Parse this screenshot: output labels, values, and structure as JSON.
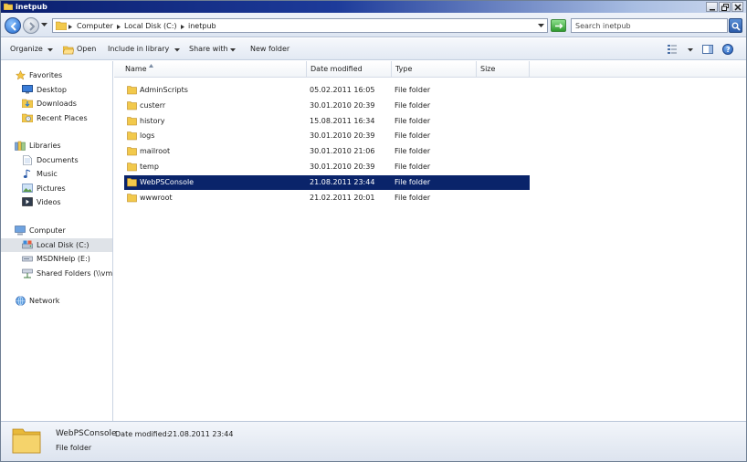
{
  "window": {
    "title": "inetpub"
  },
  "address": {
    "crumbs": [
      "Computer",
      "Local Disk (C:)",
      "inetpub"
    ],
    "search_placeholder": "Search inetpub"
  },
  "toolbar": {
    "organize": "Organize",
    "open": "Open",
    "include_in_library": "Include in library",
    "share_with": "Share with",
    "new_folder": "New folder",
    "help": "?"
  },
  "navpane": {
    "favorites": {
      "label": "Favorites",
      "items": [
        "Desktop",
        "Downloads",
        "Recent Places"
      ]
    },
    "libraries": {
      "label": "Libraries",
      "items": [
        "Documents",
        "Music",
        "Pictures",
        "Videos"
      ]
    },
    "computer": {
      "label": "Computer",
      "items": [
        "Local Disk (C:)",
        "MSDNHelp (E:)",
        "Shared Folders (\\\\vmw"
      ],
      "selected": "Local Disk (C:)"
    },
    "network": {
      "label": "Network"
    }
  },
  "filelist": {
    "columns": [
      "Name",
      "Date modified",
      "Type",
      "Size"
    ],
    "rows": [
      {
        "name": "AdminScripts",
        "date": "05.02.2011 16:05",
        "type": "File folder"
      },
      {
        "name": "custerr",
        "date": "30.01.2010 20:39",
        "type": "File folder"
      },
      {
        "name": "history",
        "date": "15.08.2011 16:34",
        "type": "File folder"
      },
      {
        "name": "logs",
        "date": "30.01.2010 20:39",
        "type": "File folder"
      },
      {
        "name": "mailroot",
        "date": "30.01.2010 21:06",
        "type": "File folder"
      },
      {
        "name": "temp",
        "date": "30.01.2010 20:39",
        "type": "File folder"
      },
      {
        "name": "WebPSConsole",
        "date": "21.08.2011 23:44",
        "type": "File folder"
      },
      {
        "name": "wwwroot",
        "date": "21.02.2011 20:01",
        "type": "File folder"
      }
    ],
    "selected": "WebPSConsole"
  },
  "details": {
    "name": "WebPSConsole",
    "date_label": "Date modified:",
    "date": "21.08.2011 23:44",
    "type": "File folder"
  },
  "colors": {
    "title_bar": "#0b1f6e",
    "selection": "#0a246a",
    "folder_yellow": "#f2c94c"
  }
}
